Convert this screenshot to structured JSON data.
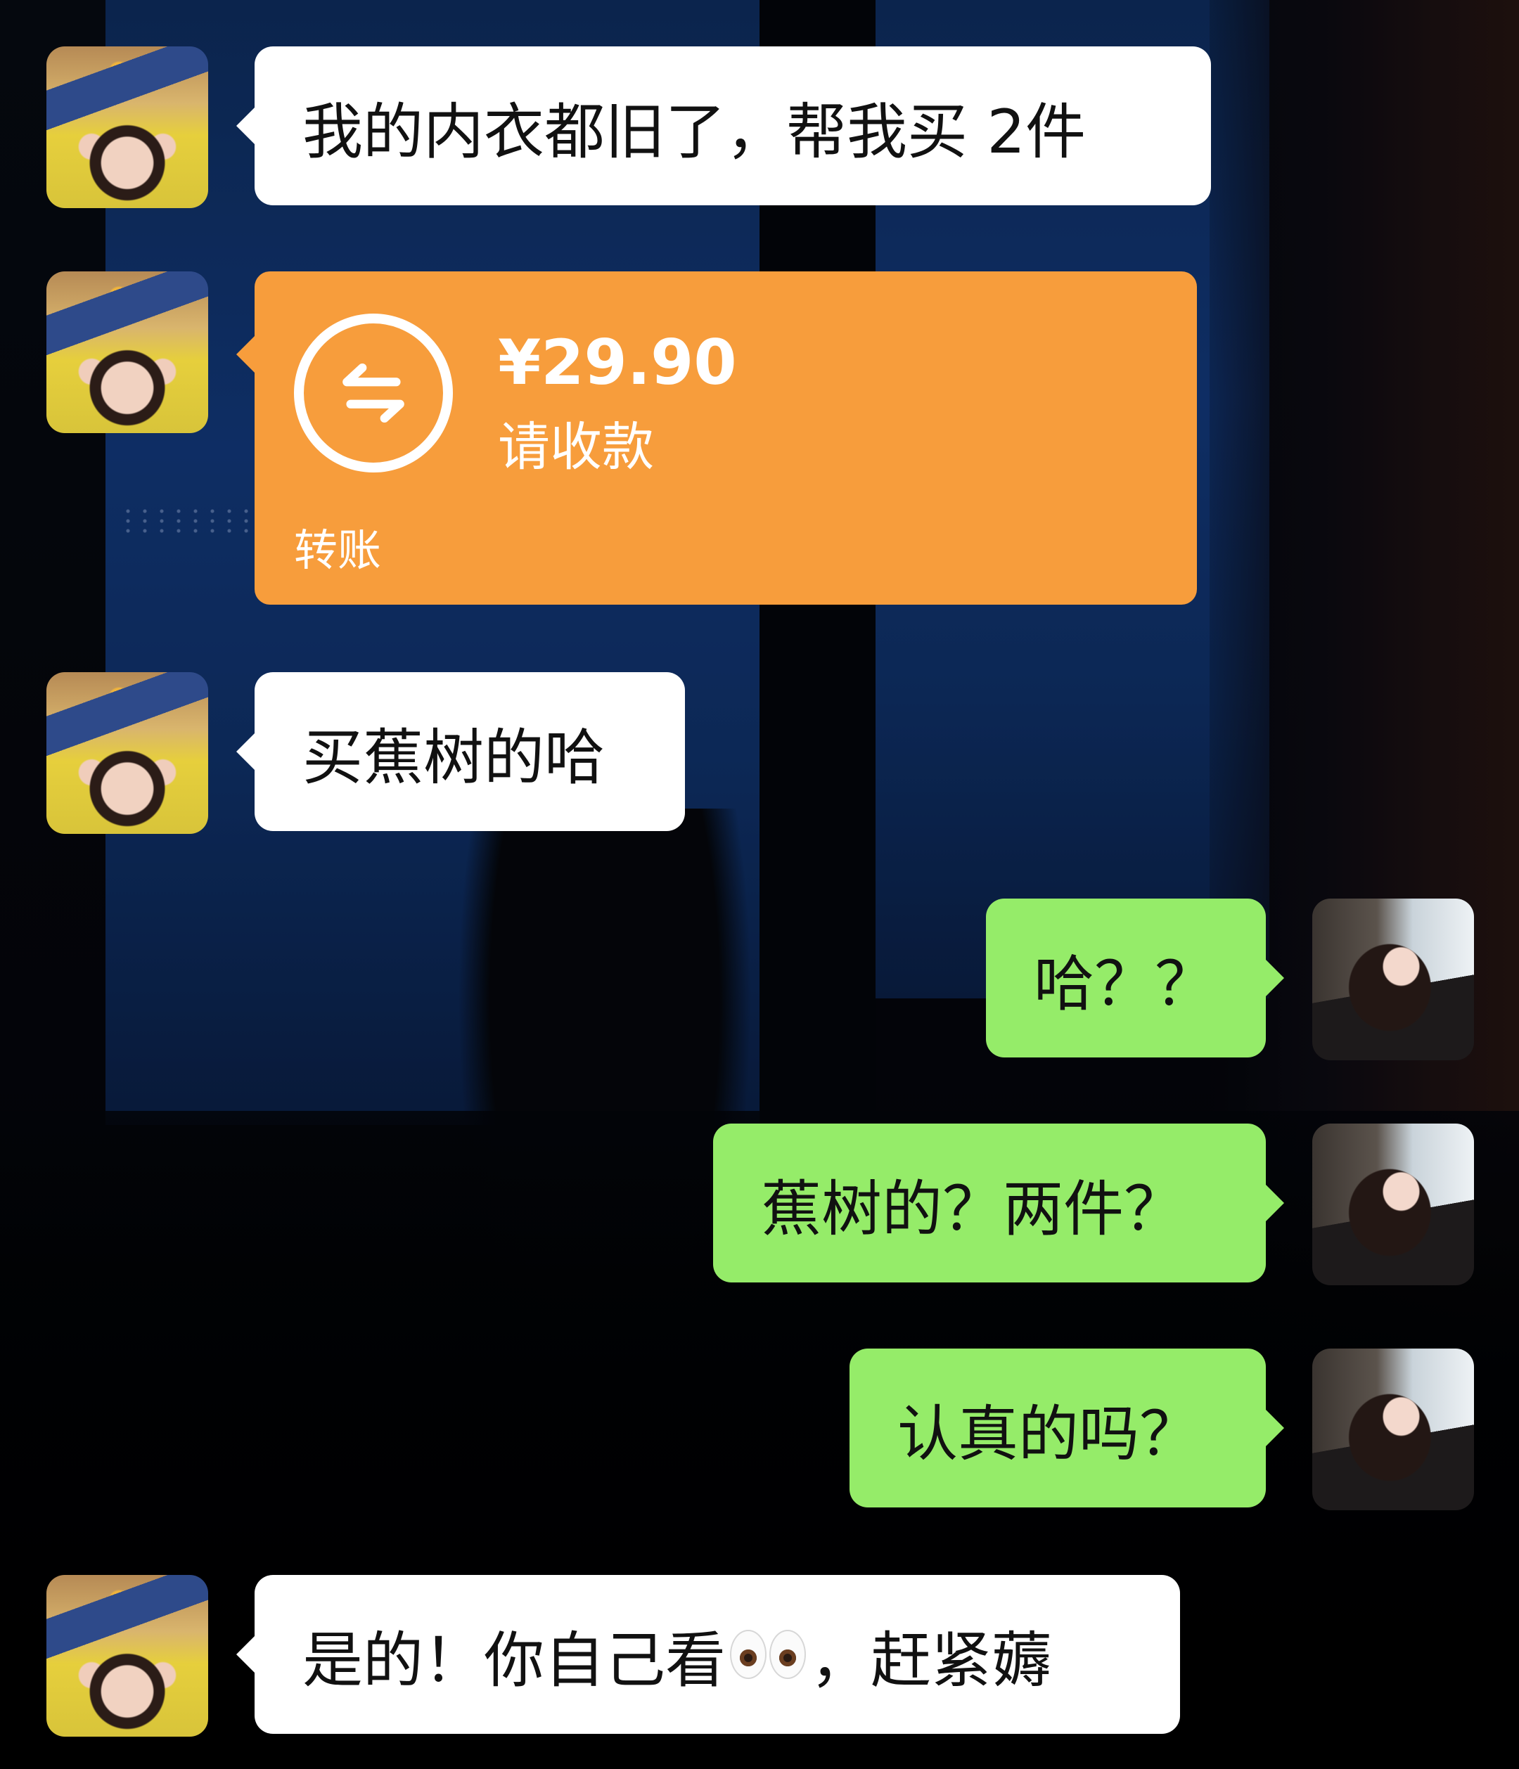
{
  "messages": [
    {
      "side": "left",
      "type": "text",
      "text": "我的内衣都旧了，帮我买 2件"
    },
    {
      "side": "left",
      "type": "transfer",
      "amount": "¥29.90",
      "status": "请收款",
      "label": "转账",
      "color": "#f79d3c"
    },
    {
      "side": "left",
      "type": "text",
      "text": "买蕉树的哈"
    },
    {
      "side": "right",
      "type": "text",
      "text": "哈？？"
    },
    {
      "side": "right",
      "type": "text",
      "text": "蕉树的？两件？"
    },
    {
      "side": "right",
      "type": "text",
      "text": "认真的吗？"
    },
    {
      "side": "left",
      "type": "text",
      "text_before": "是的！你自己看",
      "emoji": "eyes-emoji",
      "text_after": "，赶紧薅"
    }
  ],
  "colors": {
    "incoming_bubble": "#ffffff",
    "outgoing_bubble": "#95ec69",
    "transfer_card": "#f79d3c"
  }
}
